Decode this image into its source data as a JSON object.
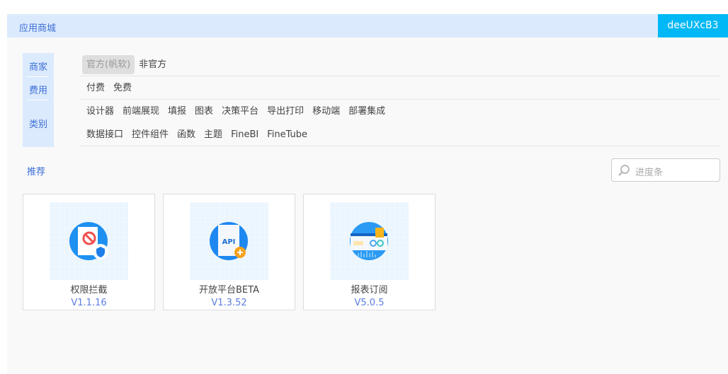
{
  "header": {
    "title": "应用商城",
    "user": "deeUXcB3"
  },
  "filters": {
    "merchant_label": "商家",
    "merchant_options": [
      "官方(帆软)",
      "非官方"
    ],
    "fee_label": "费用",
    "fee_options": [
      "付费",
      "免费"
    ],
    "category_label": "类别",
    "category_row1": [
      "设计器",
      "前端展现",
      "填报",
      "图表",
      "决策平台",
      "导出打印",
      "移动端",
      "部署集成"
    ],
    "category_row2": [
      "数据接口",
      "控件组件",
      "函数",
      "主题",
      "FineBI",
      "FineTube"
    ]
  },
  "recommend_label": "推荐",
  "search": {
    "placeholder": "进度条"
  },
  "plugins": [
    {
      "name": "权限拦截",
      "version": "V1.1.16",
      "icon": "permission-block-icon"
    },
    {
      "name": "开放平台BETA",
      "version": "V1.3.52",
      "icon": "api-icon"
    },
    {
      "name": "报表订阅",
      "version": "V5.0.5",
      "icon": "report-subscribe-icon"
    }
  ]
}
